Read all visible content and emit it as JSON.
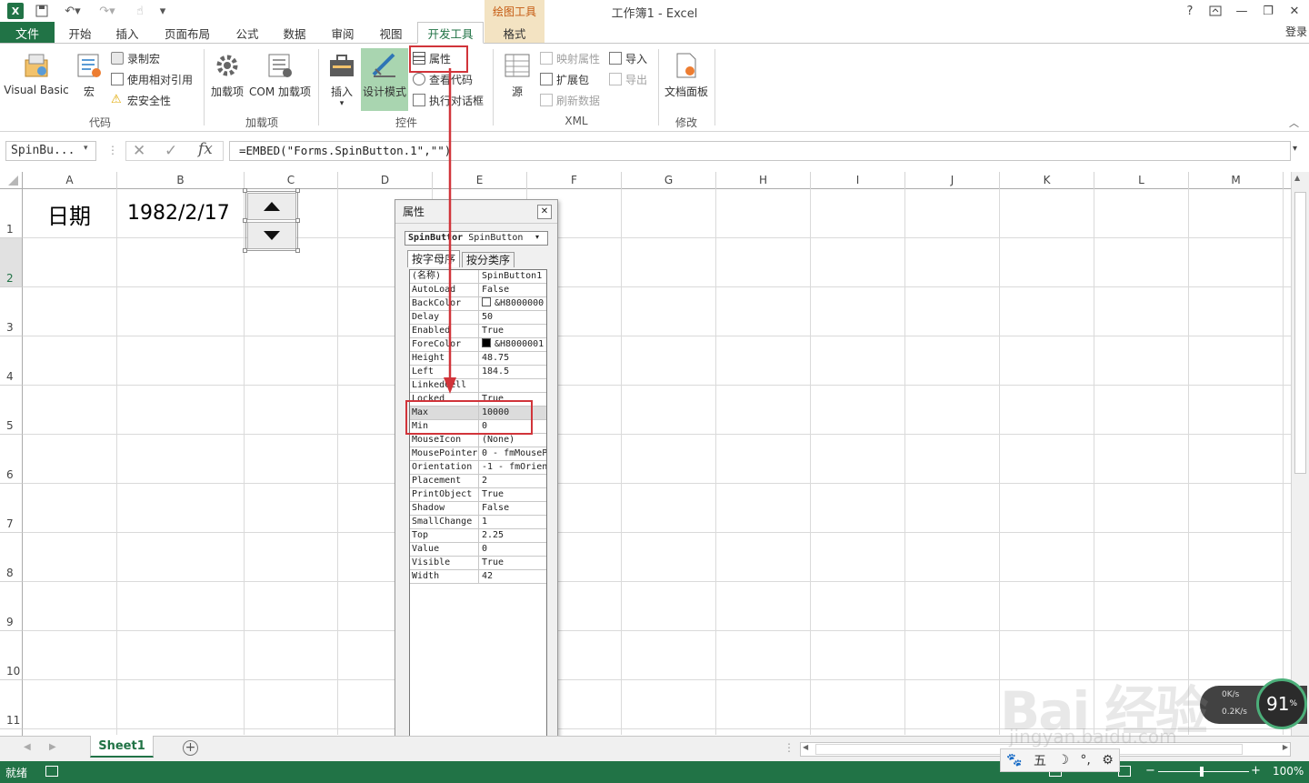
{
  "window": {
    "title": "工作簿1 - Excel",
    "context_group": "绘图工具",
    "help": "?",
    "signin": "登录"
  },
  "tabs": [
    "开始",
    "插入",
    "页面布局",
    "公式",
    "数据",
    "审阅",
    "视图",
    "开发工具",
    "格式"
  ],
  "file_tab": "文件",
  "ribbon": {
    "code": {
      "label": "代码",
      "visual_basic": "Visual Basic",
      "macro": "宏",
      "record_macro": "录制宏",
      "relative_ref": "使用相对引用",
      "macro_security": "宏安全性"
    },
    "addins": {
      "label": "加载项",
      "addins": "加载项",
      "com_addins": "COM 加载项"
    },
    "controls": {
      "label": "控件",
      "insert": "插入",
      "design_mode": "设计模式",
      "properties": "属性",
      "view_code": "查看代码",
      "run_dialog": "执行对话框"
    },
    "xml": {
      "label": "XML",
      "source": "源",
      "map_props": "映射属性",
      "expansion": "扩展包",
      "refresh": "刷新数据",
      "import": "导入",
      "export": "导出"
    },
    "modify": {
      "label": "修改",
      "doc_panel": "文档面板"
    }
  },
  "formula_bar": {
    "name_box": "SpinBu...",
    "fx": "fx",
    "formula": "=EMBED(\"Forms.SpinButton.1\",\"\")"
  },
  "grid": {
    "columns": [
      "A",
      "B",
      "C",
      "D",
      "E",
      "F",
      "G",
      "H",
      "I",
      "J",
      "K",
      "L",
      "M"
    ],
    "rows": [
      "1",
      "2",
      "3",
      "4",
      "5",
      "6",
      "7",
      "8",
      "9",
      "10",
      "11"
    ],
    "cells": {
      "A1": "日期",
      "B1": "1982/2/17"
    }
  },
  "properties_window": {
    "title": "属性",
    "object_name": "SpinButtor",
    "object_type": "SpinButton",
    "tab_alpha": "按字母序",
    "tab_category": "按分类序",
    "rows": [
      {
        "name": "(名称)",
        "value": "SpinButton1"
      },
      {
        "name": "AutoLoad",
        "value": "False"
      },
      {
        "name": "BackColor",
        "value": "&H8000000",
        "swatch": "#ffffff"
      },
      {
        "name": "Delay",
        "value": "50"
      },
      {
        "name": "Enabled",
        "value": "True"
      },
      {
        "name": "ForeColor",
        "value": "&H8000001",
        "swatch": "#000000"
      },
      {
        "name": "Height",
        "value": "48.75"
      },
      {
        "name": "Left",
        "value": "184.5"
      },
      {
        "name": "LinkedCell",
        "value": ""
      },
      {
        "name": "Locked",
        "value": "True"
      },
      {
        "name": "Max",
        "value": "10000"
      },
      {
        "name": "Min",
        "value": "0"
      },
      {
        "name": "MouseIcon",
        "value": "(None)"
      },
      {
        "name": "MousePointer",
        "value": "0 - fmMouseP"
      },
      {
        "name": "Orientation",
        "value": "-1 - fmOrien"
      },
      {
        "name": "Placement",
        "value": "2"
      },
      {
        "name": "PrintObject",
        "value": "True"
      },
      {
        "name": "Shadow",
        "value": "False"
      },
      {
        "name": "SmallChange",
        "value": "1"
      },
      {
        "name": "Top",
        "value": "2.25"
      },
      {
        "name": "Value",
        "value": "0"
      },
      {
        "name": "Visible",
        "value": "True"
      },
      {
        "name": "Width",
        "value": "42"
      }
    ]
  },
  "sheet_tabs": [
    "Sheet1"
  ],
  "status": {
    "ready": "就绪",
    "zoom": "100%",
    "speed_up": "0K/s",
    "speed_down": "0.2K/s",
    "cpu": "91",
    "cpu_unit": "%",
    "ime_label": "五"
  },
  "watermark": {
    "brand": "Bai 经验",
    "url": "jingyan.baidu.com"
  },
  "colors": {
    "excel_green": "#217346",
    "annotation_red": "#d1343a",
    "context_tab": "#f3e3c2"
  }
}
